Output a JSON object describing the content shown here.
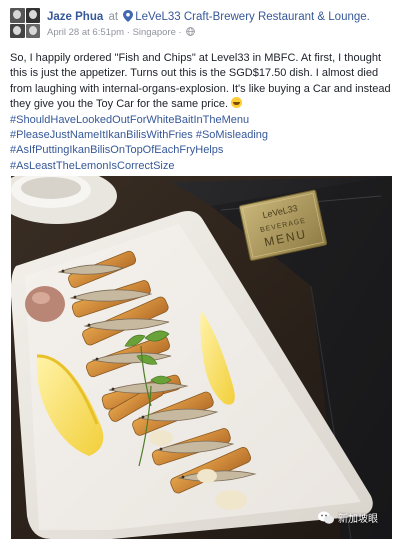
{
  "post": {
    "author": "Jaze Phua",
    "at_word": "at",
    "place": "LeVeL33 Craft-Brewery Restaurant & Lounge.",
    "date": "April 28 at 6:51pm",
    "separator": "·",
    "location": "Singapore",
    "location_separator": "·",
    "body": "So, I happily ordered \"Fish and Chips\" at Level33 in MBFC. At first, I thought this is just the appetizer. Turns out this is the SGD$17.50 dish. I almost died from laughing with internal-organs-explosion. It's like buying a Car and instead they give you the Toy Car for the same price.",
    "hashtags": [
      "#ShouldHaveLookedOutForWhiteBaitInTheMenu",
      "#PleaseJustNameItIkanBilisWithFries #SoMisleading",
      "#AsIfPuttingIkanBilisOnTopOfEachFryHelps",
      "#AsLeastTheLemonIsCorrectSize"
    ]
  },
  "photo": {
    "menu_text_line1": "LeVeL33",
    "menu_text_line2": "BEVERAGE",
    "menu_text_line3": "MENU"
  },
  "watermark": {
    "text": "新加坡眼"
  },
  "icons": {
    "location": "map-pin-icon",
    "privacy": "globe-icon",
    "emoji": "laughing-emoji-icon",
    "watermark": "wechat-icon"
  },
  "colors": {
    "link": "#365899",
    "meta": "#90949c",
    "text": "#1d2129"
  }
}
